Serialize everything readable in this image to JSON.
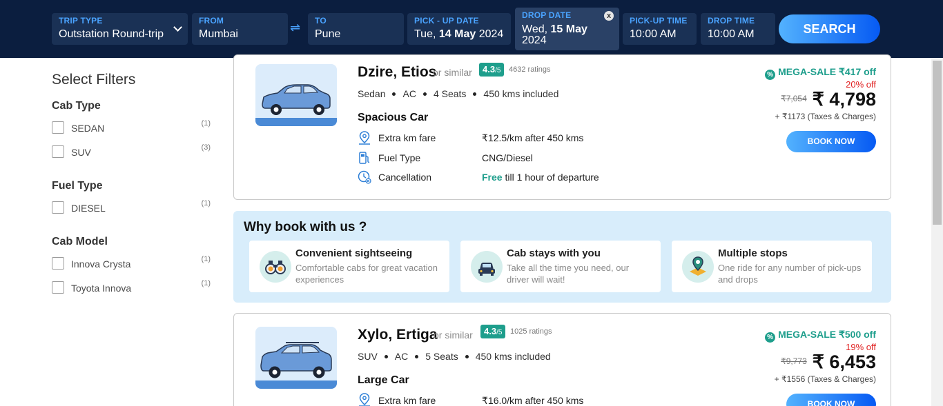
{
  "search": {
    "trip_type": {
      "label": "TRIP TYPE",
      "value": "Outstation Round-trip"
    },
    "from": {
      "label": "FROM",
      "value": "Mumbai"
    },
    "to": {
      "label": "TO",
      "value": "Pune"
    },
    "pickup_date": {
      "label": "PICK - UP DATE",
      "day": "Tue,",
      "date": "14 May",
      "year": "2024"
    },
    "drop_date": {
      "label": "DROP DATE",
      "day": "Wed,",
      "date": "15 May",
      "year": "2024",
      "clear": "x"
    },
    "pickup_time": {
      "label": "PICK-UP TIME",
      "value": "10:00 AM"
    },
    "drop_time": {
      "label": "DROP TIME",
      "value": "10:00 AM"
    },
    "swap_icon": "⇌",
    "button": "SEARCH"
  },
  "filters": {
    "title": "Select Filters",
    "groups": [
      {
        "title": "Cab Type",
        "items": [
          {
            "label": "SEDAN",
            "count": "(1)"
          },
          {
            "label": "SUV",
            "count": "(3)"
          }
        ]
      },
      {
        "title": "Fuel Type",
        "items": [
          {
            "label": "DIESEL",
            "count": "(1)"
          }
        ]
      },
      {
        "title": "Cab Model",
        "items": [
          {
            "label": "Innova Crysta",
            "count": "(1)"
          },
          {
            "label": "Toyota Innova",
            "count": "(1)"
          }
        ]
      }
    ]
  },
  "cabs": [
    {
      "name": "Dzire, Etios",
      "similar": "or similar",
      "rating": "4.3",
      "rating_suffix": "/5",
      "ratings_count": "4632 ratings",
      "specs": [
        "Sedan",
        "AC",
        "4 Seats",
        "450 kms included"
      ],
      "category": "Spacious Car",
      "features": [
        {
          "label": "Extra km fare",
          "value_main": "₹12.5/km",
          "value_rest": " after 450 kms"
        },
        {
          "label": "Fuel Type",
          "value_main": "CNG/Diesel",
          "value_rest": ""
        },
        {
          "label": "Cancellation",
          "value_free": "Free",
          "value_rest": " till 1 hour of departure"
        }
      ],
      "mega_sale": "MEGA-SALE",
      "mega_off": "₹417 off",
      "pct_off": "20% off",
      "old_price": "₹7,054",
      "price": "₹ 4,798",
      "taxes": "+ ₹1173 (Taxes & Charges)",
      "book": "BOOK NOW"
    },
    {
      "name": "Xylo, Ertiga",
      "similar": "or similar",
      "rating": "4.3",
      "rating_suffix": "/5",
      "ratings_count": "1025 ratings",
      "specs": [
        "SUV",
        "AC",
        "5 Seats",
        "450 kms included"
      ],
      "category": "Large Car",
      "features": [
        {
          "label": "Extra km fare",
          "value_main": "₹16.0/km",
          "value_rest": " after 450 kms"
        }
      ],
      "mega_sale": "MEGA-SALE",
      "mega_off": "₹500 off",
      "pct_off": "19% off",
      "old_price": "₹9,773",
      "price": "₹ 6,453",
      "taxes": "+ ₹1556 (Taxes & Charges)",
      "book": "BOOK NOW"
    }
  ],
  "why": {
    "title": "Why book with us ?",
    "cards": [
      {
        "title": "Convenient sightseeing",
        "text": "Comfortable cabs for great vacation experiences",
        "icon": "binoculars-icon"
      },
      {
        "title": "Cab stays with you",
        "text": "Take all the time you need, our driver will wait!",
        "icon": "car-icon"
      },
      {
        "title": "Multiple stops",
        "text": "One ride for any number of pick-ups and drops",
        "icon": "map-pin-icon"
      }
    ]
  },
  "colors": {
    "header_bg": "#0b1e3f",
    "accent_blue": "#4aa3ff",
    "teal": "#1e9e8c",
    "discount_red": "#e02020"
  }
}
